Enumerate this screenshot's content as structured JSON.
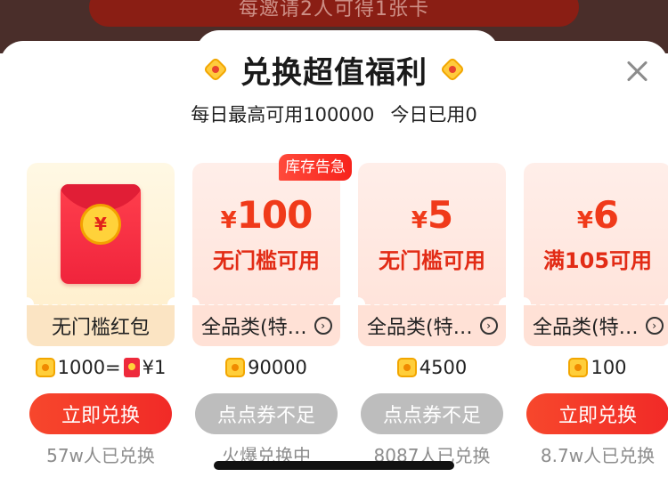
{
  "backdrop": {
    "banner_text": "每邀请2人可得1张卡"
  },
  "header": {
    "title": "兑换超值福利",
    "quota_limit": "每日最高可用100000",
    "quota_used": "今日已用0"
  },
  "stock_badge": "库存告急",
  "cards": [
    {
      "type": "red-packet",
      "label": "无门槛红包",
      "cost_left": "1000=",
      "cost_right": "¥1",
      "button": "立即兑换",
      "button_state": "enabled",
      "count": "57w人已兑换"
    },
    {
      "type": "coupon",
      "currency": "¥",
      "amount": "100",
      "desc": "无门槛可用",
      "category": "全品类(特…",
      "cost": "90000",
      "button": "点点券不足",
      "button_state": "disabled",
      "count": "火爆兑换中"
    },
    {
      "type": "coupon",
      "currency": "¥",
      "amount": "5",
      "desc": "无门槛可用",
      "category": "全品类(特…",
      "cost": "4500",
      "button": "点点券不足",
      "button_state": "disabled",
      "count": "8087人已兑换"
    },
    {
      "type": "coupon",
      "currency": "¥",
      "amount": "6",
      "desc": "满105可用",
      "category": "全品类(特…",
      "cost": "100",
      "button": "立即兑换",
      "button_state": "enabled",
      "count": "8.7w人已兑换"
    }
  ],
  "colors": {
    "accent": "#f12a27",
    "disabled": "#bdbdbd",
    "coupon_text": "#e22b15"
  },
  "icons": [
    "close-icon",
    "coin-icon",
    "red-packet-icon",
    "chevron-right-icon"
  ]
}
